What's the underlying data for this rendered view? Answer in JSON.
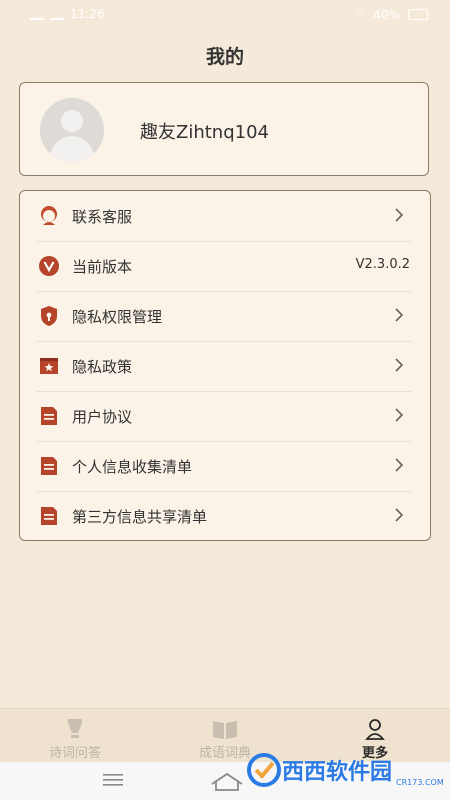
{
  "status_bar": {
    "time": "11:26",
    "battery": "40%"
  },
  "page": {
    "title": "我的"
  },
  "profile": {
    "username": "趣友Zihtnq104"
  },
  "menu": {
    "items": [
      {
        "label": "联系客服",
        "icon": "customer-service-icon",
        "chevron": true
      },
      {
        "label": "当前版本",
        "icon": "version-icon",
        "value": "V2.3.0.2",
        "chevron": false
      },
      {
        "label": "隐私权限管理",
        "icon": "privacy-shield-icon",
        "chevron": true
      },
      {
        "label": "隐私政策",
        "icon": "privacy-policy-icon",
        "chevron": true
      },
      {
        "label": "用户协议",
        "icon": "document-icon",
        "chevron": true
      },
      {
        "label": "个人信息收集清单",
        "icon": "document-icon",
        "chevron": true
      },
      {
        "label": "第三方信息共享清单",
        "icon": "document-icon",
        "chevron": true
      }
    ]
  },
  "bottom_nav": {
    "tabs": [
      {
        "label": "诗词问答",
        "icon": "pen-nib-icon",
        "active": false
      },
      {
        "label": "成语词典",
        "icon": "book-icon",
        "active": false
      },
      {
        "label": "更多",
        "icon": "user-icon",
        "active": true
      }
    ]
  },
  "watermark": {
    "text": "西西软件园",
    "sub": "CR173.COM"
  },
  "colors": {
    "background": "#f5ead9",
    "card": "#fbf3e7",
    "icon_accent": "#b5442a",
    "border": "#8a7a6a"
  }
}
